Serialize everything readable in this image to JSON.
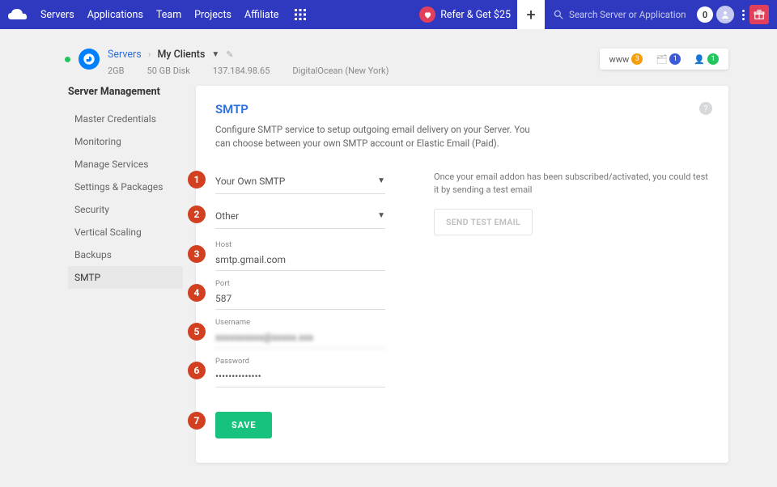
{
  "nav": {
    "links": [
      "Servers",
      "Applications",
      "Team",
      "Projects",
      "Affiliate"
    ],
    "refer_label": "Refer & Get $25",
    "search_placeholder": "Search Server or Application",
    "notif_count": "0"
  },
  "server": {
    "breadcrumb_root": "Servers",
    "name": "My Clients",
    "ram": "2GB",
    "disk": "50 GB Disk",
    "ip": "137.184.98.65",
    "provider": "DigitalOcean (New York)",
    "stats": {
      "www": "www",
      "www_n": "3",
      "folder_n": "1",
      "user_n": "1"
    }
  },
  "sidebar": {
    "title": "Server Management",
    "items": [
      {
        "label": "Master Credentials"
      },
      {
        "label": "Monitoring"
      },
      {
        "label": "Manage Services"
      },
      {
        "label": "Settings & Packages"
      },
      {
        "label": "Security"
      },
      {
        "label": "Vertical Scaling"
      },
      {
        "label": "Backups"
      },
      {
        "label": "SMTP",
        "active": true
      }
    ]
  },
  "panel": {
    "title": "SMTP",
    "desc": "Configure SMTP service to setup outgoing email delivery on your Server. You can choose between your own SMTP account or Elastic Email (Paid).",
    "info": "Once your email addon has been subscribed/activated, you could test it by sending a test email",
    "test_btn": "SEND TEST EMAIL",
    "select1": "Your Own SMTP",
    "select2": "Other",
    "host_label": "Host",
    "host_value": "smtp.gmail.com",
    "port_label": "Port",
    "port_value": "587",
    "user_label": "Username",
    "user_value": "xxxxxxxxxx@xxxxx.xxx",
    "pass_label": "Password",
    "pass_value": "••••••••••••••",
    "save": "SAVE"
  },
  "annotations": [
    "1",
    "2",
    "3",
    "4",
    "5",
    "6",
    "7"
  ]
}
